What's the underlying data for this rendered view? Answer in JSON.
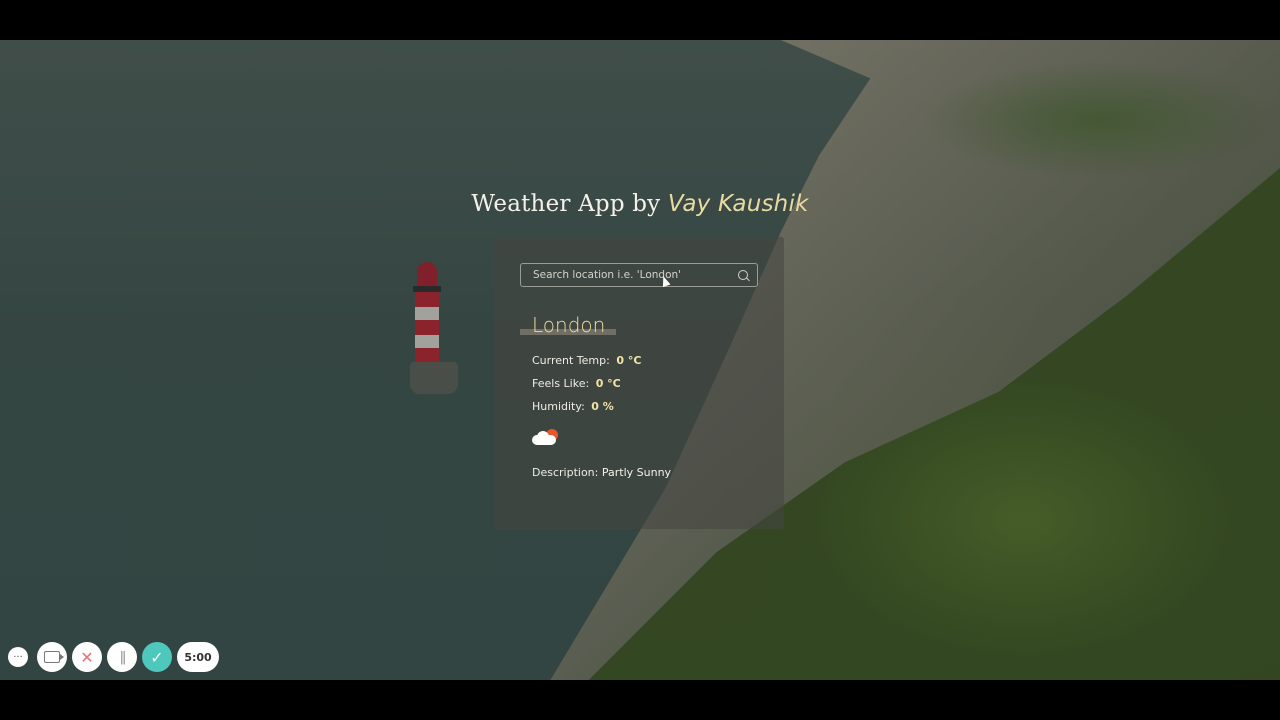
{
  "page": {
    "title_main": "Weather App by ",
    "title_author": "Vay Kaushik"
  },
  "search": {
    "placeholder": "Search location i.e. 'London'",
    "value": ""
  },
  "weather": {
    "city": "London",
    "current_temp_label": "Current Temp:",
    "current_temp_value": "0 °C",
    "feels_like_label": "Feels Like:",
    "feels_like_value": "0 °C",
    "humidity_label": "Humidity:",
    "humidity_value": "0 %",
    "icon": "partly-sunny-icon",
    "description_label": "Description:",
    "description_value": "Partly Sunny"
  },
  "recorder": {
    "more_label": "···",
    "close_label": "✕",
    "pause_label": "||",
    "check_label": "✓",
    "timer": "5:00"
  },
  "colors": {
    "accent_yellow": "#f2e3a6",
    "card_bg": "rgba(70,70,66,0.55)",
    "recorder_check": "#4ec7bc",
    "recorder_close": "#e57373"
  }
}
